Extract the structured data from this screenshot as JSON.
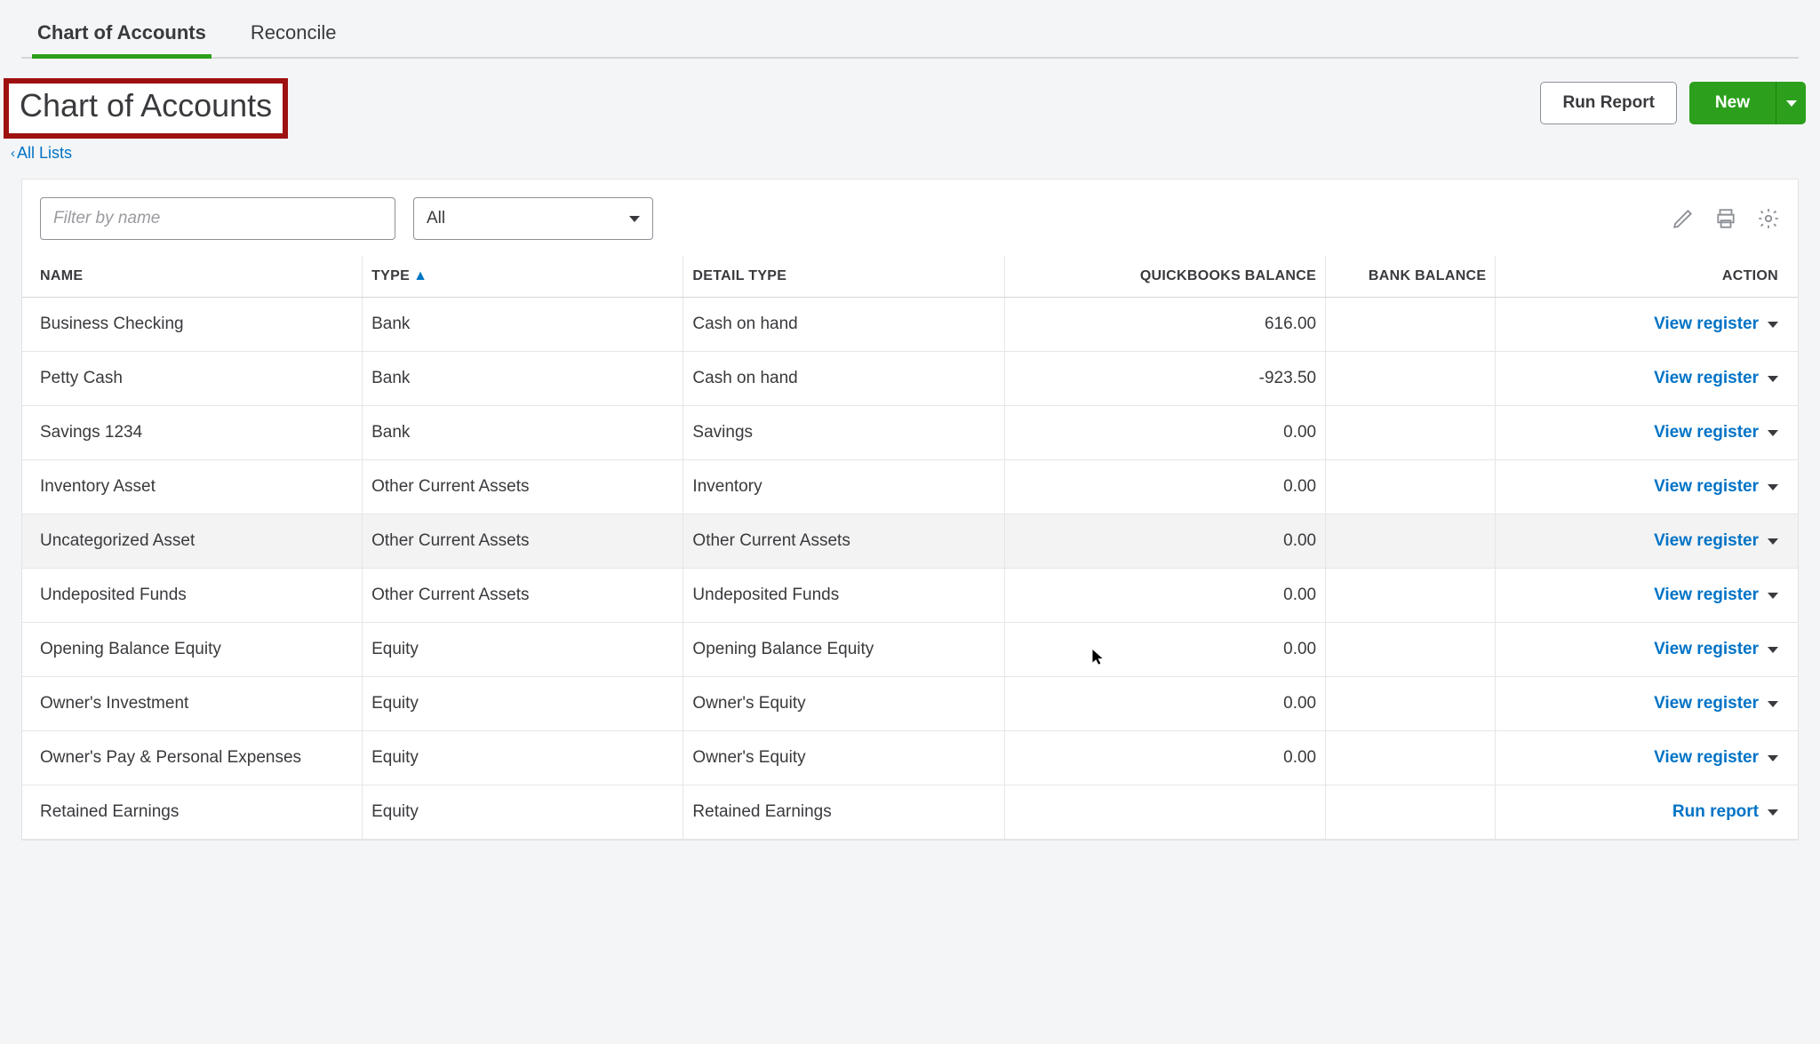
{
  "tabs": {
    "chart": "Chart of Accounts",
    "reconcile": "Reconcile"
  },
  "title": "Chart of Accounts",
  "all_lists": "All Lists",
  "buttons": {
    "run_report": "Run Report",
    "new": "New"
  },
  "filter": {
    "placeholder": "Filter by name",
    "value": ""
  },
  "type_filter": {
    "selected": "All"
  },
  "columns": {
    "name": "NAME",
    "type": "TYPE",
    "detail": "DETAIL TYPE",
    "qb_balance": "QUICKBOOKS BALANCE",
    "bank_balance": "BANK BALANCE",
    "action": "ACTION"
  },
  "rows": [
    {
      "name": "Business Checking",
      "type": "Bank",
      "detail": "Cash on hand",
      "qb": "616.00",
      "bank": "",
      "action": "View register"
    },
    {
      "name": "Petty Cash",
      "type": "Bank",
      "detail": "Cash on hand",
      "qb": "-923.50",
      "bank": "",
      "action": "View register"
    },
    {
      "name": "Savings 1234",
      "type": "Bank",
      "detail": "Savings",
      "qb": "0.00",
      "bank": "",
      "action": "View register"
    },
    {
      "name": "Inventory Asset",
      "type": "Other Current Assets",
      "detail": "Inventory",
      "qb": "0.00",
      "bank": "",
      "action": "View register"
    },
    {
      "name": "Uncategorized Asset",
      "type": "Other Current Assets",
      "detail": "Other Current Assets",
      "qb": "0.00",
      "bank": "",
      "action": "View register"
    },
    {
      "name": "Undeposited Funds",
      "type": "Other Current Assets",
      "detail": "Undeposited Funds",
      "qb": "0.00",
      "bank": "",
      "action": "View register"
    },
    {
      "name": "Opening Balance Equity",
      "type": "Equity",
      "detail": "Opening Balance Equity",
      "qb": "0.00",
      "bank": "",
      "action": "View register"
    },
    {
      "name": "Owner's Investment",
      "type": "Equity",
      "detail": "Owner's Equity",
      "qb": "0.00",
      "bank": "",
      "action": "View register"
    },
    {
      "name": "Owner's Pay & Personal Expenses",
      "type": "Equity",
      "detail": "Owner's Equity",
      "qb": "0.00",
      "bank": "",
      "action": "View register"
    },
    {
      "name": "Retained Earnings",
      "type": "Equity",
      "detail": "Retained Earnings",
      "qb": "",
      "bank": "",
      "action": "Run report"
    }
  ],
  "hover_row_index": 4
}
